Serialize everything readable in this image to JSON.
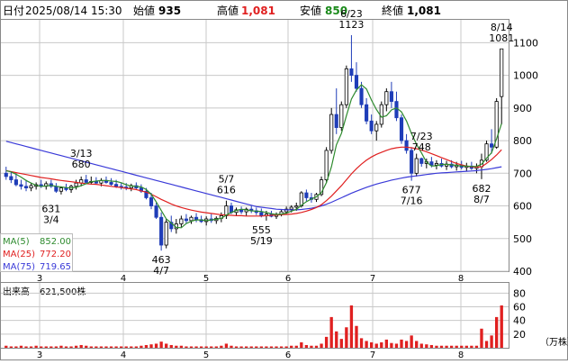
{
  "header": {
    "date_label": "日付",
    "datetime": "2025/08/14 15:30",
    "open_label": "始値",
    "open_value": "935",
    "high_label": "高値",
    "high_value": "1,081",
    "low_label": "安値",
    "low_value": "850",
    "close_label": "終値",
    "close_value": "1,081"
  },
  "legend": {
    "ma5_label": "MA(5)",
    "ma5_value": "852.00",
    "ma25_label": "MA(25)",
    "ma25_value": "772.20",
    "ma75_label": "MA(75)",
    "ma75_value": "719.65"
  },
  "volume_header": {
    "label": "出来高",
    "value": "621,500株"
  },
  "volume_unit": "（万株）",
  "colors": {
    "up": "#ffffff",
    "down": "#1f3db8",
    "ma5": "#2e8b2e",
    "ma25": "#e02020",
    "ma75": "#3a3ad8",
    "volume": "#e02020",
    "high_value": "#e02020",
    "low_value": "#1a8a1a",
    "grid": "#c8c8c8"
  },
  "chart_data": [
    {
      "type": "candlestick",
      "title": "",
      "x_ticks": [
        "3",
        "4",
        "5",
        "6",
        "7",
        "8"
      ],
      "y_ticks": [
        400,
        500,
        600,
        700,
        800,
        900,
        1000,
        1100
      ],
      "ylim": [
        400,
        1170
      ],
      "grid": true,
      "candles": [
        [
          700,
          720,
          680,
          690
        ],
        [
          690,
          705,
          670,
          680
        ],
        [
          680,
          700,
          660,
          665
        ],
        [
          665,
          680,
          650,
          660
        ],
        [
          660,
          680,
          645,
          655
        ],
        [
          655,
          670,
          645,
          662
        ],
        [
          660,
          672,
          650,
          665
        ],
        [
          665,
          680,
          655,
          660
        ],
        [
          660,
          675,
          650,
          668
        ],
        [
          668,
          680,
          655,
          660
        ],
        [
          660,
          670,
          640,
          645
        ],
        [
          645,
          660,
          635,
          655
        ],
        [
          655,
          668,
          645,
          650
        ],
        [
          650,
          665,
          640,
          660
        ],
        [
          660,
          680,
          650,
          670
        ],
        [
          670,
          690,
          660,
          680
        ],
        [
          680,
          695,
          670,
          672
        ],
        [
          672,
          690,
          665,
          675
        ],
        [
          675,
          688,
          665,
          670
        ],
        [
          670,
          685,
          660,
          678
        ],
        [
          678,
          690,
          668,
          672
        ],
        [
          672,
          685,
          662,
          666
        ],
        [
          666,
          680,
          655,
          660
        ],
        [
          660,
          672,
          650,
          658
        ],
        [
          658,
          670,
          648,
          655
        ],
        [
          655,
          668,
          645,
          662
        ],
        [
          662,
          672,
          650,
          655
        ],
        [
          655,
          666,
          640,
          645
        ],
        [
          645,
          655,
          620,
          625
        ],
        [
          625,
          640,
          590,
          600
        ],
        [
          600,
          610,
          560,
          565
        ],
        [
          565,
          580,
          463,
          480
        ],
        [
          480,
          560,
          470,
          550
        ],
        [
          550,
          570,
          520,
          530
        ],
        [
          530,
          560,
          515,
          545
        ],
        [
          545,
          570,
          535,
          560
        ],
        [
          560,
          575,
          545,
          555
        ],
        [
          555,
          570,
          545,
          565
        ],
        [
          565,
          578,
          550,
          558
        ],
        [
          558,
          570,
          548,
          552
        ],
        [
          552,
          568,
          540,
          560
        ],
        [
          560,
          575,
          548,
          555
        ],
        [
          555,
          568,
          545,
          562
        ],
        [
          562,
          580,
          550,
          570
        ],
        [
          570,
          616,
          560,
          600
        ],
        [
          600,
          610,
          575,
          580
        ],
        [
          580,
          595,
          570,
          588
        ],
        [
          588,
          598,
          575,
          582
        ],
        [
          582,
          595,
          570,
          590
        ],
        [
          590,
          600,
          578,
          585
        ],
        [
          585,
          595,
          572,
          580
        ],
        [
          580,
          592,
          565,
          570
        ],
        [
          570,
          585,
          555,
          575
        ],
        [
          575,
          585,
          565,
          568
        ],
        [
          568,
          580,
          560,
          574
        ],
        [
          574,
          590,
          568,
          582
        ],
        [
          582,
          598,
          575,
          590
        ],
        [
          590,
          602,
          580,
          596
        ],
        [
          596,
          610,
          585,
          600
        ],
        [
          600,
          645,
          595,
          640
        ],
        [
          640,
          650,
          615,
          625
        ],
        [
          625,
          640,
          610,
          620
        ],
        [
          620,
          640,
          612,
          635
        ],
        [
          635,
          690,
          630,
          680
        ],
        [
          680,
          780,
          670,
          770
        ],
        [
          770,
          900,
          760,
          880
        ],
        [
          880,
          960,
          820,
          840
        ],
        [
          840,
          920,
          830,
          910
        ],
        [
          910,
          1030,
          900,
          1020
        ],
        [
          1020,
          1123,
          980,
          1000
        ],
        [
          1000,
          1040,
          950,
          960
        ],
        [
          960,
          980,
          900,
          910
        ],
        [
          910,
          930,
          850,
          860
        ],
        [
          860,
          880,
          820,
          830
        ],
        [
          830,
          860,
          800,
          850
        ],
        [
          850,
          920,
          840,
          910
        ],
        [
          910,
          960,
          890,
          950
        ],
        [
          950,
          980,
          900,
          920
        ],
        [
          920,
          950,
          860,
          870
        ],
        [
          870,
          880,
          790,
          800
        ],
        [
          800,
          820,
          760,
          770
        ],
        [
          770,
          780,
          677,
          700
        ],
        [
          700,
          760,
          690,
          745
        ],
        [
          745,
          748,
          720,
          730
        ],
        [
          730,
          745,
          715,
          735
        ],
        [
          735,
          750,
          718,
          725
        ],
        [
          725,
          740,
          712,
          730
        ],
        [
          730,
          745,
          718,
          722
        ],
        [
          722,
          738,
          710,
          728
        ],
        [
          728,
          740,
          715,
          720
        ],
        [
          720,
          735,
          708,
          725
        ],
        [
          725,
          738,
          712,
          718
        ],
        [
          718,
          732,
          705,
          722
        ],
        [
          722,
          735,
          710,
          715
        ],
        [
          715,
          730,
          700,
          720
        ],
        [
          720,
          760,
          682,
          740
        ],
        [
          740,
          800,
          735,
          790
        ],
        [
          790,
          835,
          760,
          780
        ],
        [
          780,
          930,
          775,
          920
        ],
        [
          935,
          1081,
          850,
          1081
        ]
      ],
      "ma5": [
        708,
        704,
        697,
        688,
        678,
        670,
        663,
        660,
        661,
        663,
        660,
        658,
        656,
        655,
        657,
        662,
        668,
        674,
        676,
        678,
        678,
        676,
        675,
        671,
        665,
        661,
        660,
        658,
        650,
        636,
        612,
        586,
        560,
        548,
        534,
        533,
        546,
        553,
        557,
        557,
        555,
        557,
        559,
        562,
        572,
        580,
        586,
        590,
        588,
        585,
        584,
        583,
        580,
        576,
        574,
        575,
        578,
        584,
        589,
        602,
        613,
        621,
        628,
        641,
        671,
        720,
        787,
        822,
        877,
        927,
        955,
        971,
        958,
        924,
        895,
        872,
        876,
        894,
        900,
        888,
        860,
        822,
        789,
        762,
        734,
        722,
        723,
        727,
        727,
        726,
        724,
        722,
        722,
        721,
        721,
        728,
        746,
        763,
        806,
        852
      ],
      "ma25": [
        708,
        705,
        702,
        699,
        696,
        693,
        690,
        687,
        685,
        683,
        680,
        678,
        676,
        674,
        672,
        670,
        668,
        667,
        666,
        664,
        662,
        660,
        658,
        656,
        654,
        652,
        650,
        646,
        642,
        636,
        628,
        620,
        613,
        606,
        600,
        595,
        591,
        587,
        584,
        581,
        579,
        577,
        575,
        573,
        572,
        571,
        570,
        570,
        569,
        569,
        569,
        569,
        570,
        571,
        572,
        573,
        574,
        575,
        577,
        580,
        584,
        589,
        595,
        604,
        616,
        630,
        646,
        662,
        680,
        698,
        714,
        728,
        740,
        750,
        758,
        764,
        770,
        775,
        778,
        780,
        780,
        778,
        775,
        771,
        766,
        760,
        754,
        748,
        742,
        736,
        730,
        726,
        722,
        720,
        719,
        720,
        730,
        742,
        756,
        772
      ],
      "ma75": [
        798,
        794,
        790,
        786,
        782,
        778,
        774,
        770,
        766,
        762,
        758,
        754,
        750,
        746,
        742,
        738,
        734,
        730,
        726,
        722,
        718,
        714,
        710,
        706,
        702,
        698,
        694,
        690,
        686,
        682,
        678,
        674,
        670,
        666,
        662,
        658,
        654,
        650,
        646,
        642,
        638,
        634,
        630,
        626,
        622,
        618,
        614,
        610,
        606,
        602,
        598,
        596,
        594,
        592,
        590,
        589,
        588,
        588,
        588,
        589,
        591,
        593,
        596,
        600,
        605,
        611,
        618,
        625,
        632,
        639,
        645,
        651,
        657,
        662,
        667,
        671,
        675,
        679,
        682,
        685,
        688,
        690,
        692,
        694,
        696,
        698,
        700,
        701,
        702,
        703,
        704,
        705,
        706,
        707,
        708,
        710,
        712,
        714,
        717,
        720
      ],
      "annotations": [
        {
          "date": "3/13",
          "value": "680",
          "index": 15,
          "price": 695,
          "pos": "above"
        },
        {
          "date": "3/4",
          "value": "631",
          "index": 9,
          "price": 620,
          "pos": "below"
        },
        {
          "date": "4/7",
          "value": "463",
          "index": 31,
          "price": 463,
          "pos": "below"
        },
        {
          "date": "5/7",
          "value": "616",
          "index": 44,
          "price": 616,
          "pos": "above"
        },
        {
          "date": "5/19",
          "value": "555",
          "index": 51,
          "price": 555,
          "pos": "below"
        },
        {
          "date": "6/23",
          "value": "1123",
          "index": 69,
          "price": 1123,
          "pos": "above"
        },
        {
          "date": "7/16",
          "value": "677",
          "index": 81,
          "price": 677,
          "pos": "below"
        },
        {
          "date": "7/23",
          "value": "748",
          "index": 83,
          "price": 748,
          "pos": "above"
        },
        {
          "date": "8/7",
          "value": "682",
          "index": 95,
          "price": 682,
          "pos": "below"
        },
        {
          "date": "8/14",
          "value": "1081",
          "index": 99,
          "price": 1081,
          "pos": "above"
        }
      ]
    },
    {
      "type": "bar",
      "title": "",
      "ylabel": "（万株）",
      "y_ticks": [
        20,
        40,
        60,
        80
      ],
      "ylim": [
        0,
        95
      ],
      "values": [
        3,
        2,
        2,
        3,
        2,
        2,
        3,
        2,
        2,
        2,
        2,
        3,
        2,
        2,
        3,
        4,
        3,
        2,
        2,
        2,
        2,
        2,
        2,
        2,
        2,
        2,
        2,
        3,
        4,
        5,
        6,
        9,
        6,
        4,
        3,
        3,
        2,
        2,
        2,
        2,
        2,
        2,
        2,
        3,
        6,
        3,
        2,
        2,
        2,
        2,
        2,
        2,
        2,
        2,
        2,
        2,
        2,
        3,
        3,
        8,
        4,
        3,
        3,
        6,
        16,
        45,
        24,
        13,
        30,
        62,
        32,
        14,
        10,
        8,
        6,
        8,
        12,
        7,
        6,
        12,
        10,
        18,
        10,
        6,
        5,
        4,
        3,
        3,
        3,
        3,
        3,
        3,
        3,
        3,
        3,
        28,
        10,
        18,
        45,
        62
      ]
    }
  ]
}
